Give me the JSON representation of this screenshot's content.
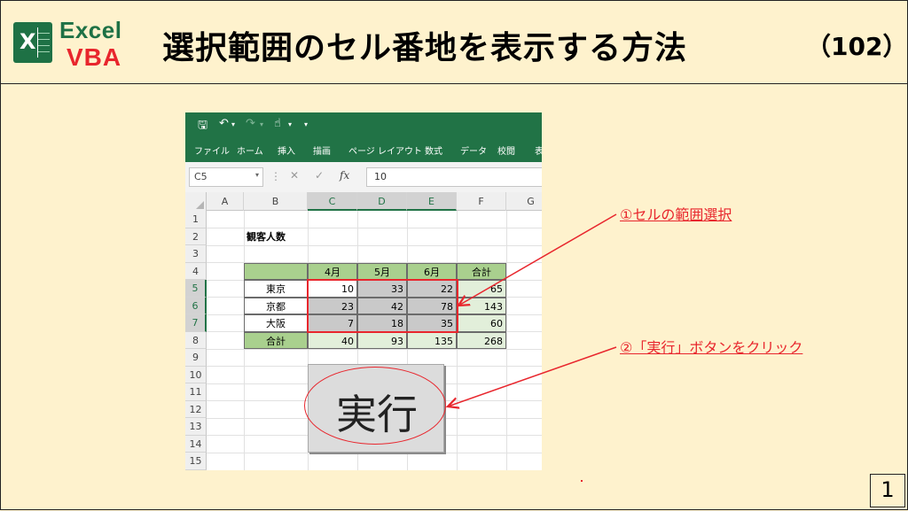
{
  "slide": {
    "title": "選択範囲のセル番地を表示する方法",
    "episode": "（102）",
    "page_number": "1",
    "logo": {
      "top": "Excel",
      "bottom": "VBA",
      "icon": "excel-icon"
    }
  },
  "excel": {
    "ribbon_tabs": [
      "ファイル",
      "ホーム",
      "挿入",
      "描画",
      "ページ レイアウト",
      "数式",
      "データ",
      "校閲",
      "表"
    ],
    "name_box": "C5",
    "formula_value": "10",
    "columns": [
      "A",
      "B",
      "C",
      "D",
      "E",
      "F",
      "G"
    ],
    "selected_columns": [
      "C",
      "D",
      "E"
    ],
    "rows": [
      "1",
      "2",
      "3",
      "4",
      "5",
      "6",
      "7",
      "8",
      "9",
      "10",
      "11",
      "12",
      "13",
      "14",
      "15"
    ],
    "selected_rows": [
      "5",
      "6",
      "7"
    ],
    "sheet_title": "観客人数",
    "table": {
      "header": [
        "",
        "4月",
        "5月",
        "6月",
        "合計"
      ],
      "body": [
        [
          "東京",
          "10",
          "33",
          "22",
          "65"
        ],
        [
          "京都",
          "23",
          "42",
          "78",
          "143"
        ],
        [
          "大阪",
          "7",
          "18",
          "35",
          "60"
        ]
      ],
      "total": [
        "合計",
        "40",
        "93",
        "135",
        "268"
      ]
    },
    "execute_button": "実行"
  },
  "annotations": {
    "step1": "①セルの範囲選択",
    "step2": "②「実行」ボタンをクリック"
  },
  "colors": {
    "excel_green": "#217346",
    "accent_red": "#e8262d",
    "slide_bg": "#fef2cd"
  }
}
